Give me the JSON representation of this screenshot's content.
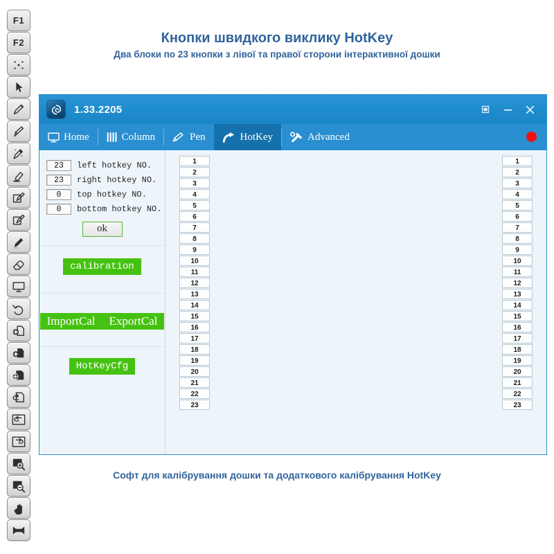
{
  "headings": {
    "title": "Кнопки швидкого виклику HotKey",
    "subtitle": "Два блоки по 23 кнопки з лівої та правої сторони інтерактивної дошки",
    "caption": "Софт для калібрування дошки та додаткового калібрування HotKey",
    "accent_color": "#31639c"
  },
  "toolbar": {
    "items": [
      {
        "name": "f1-key",
        "label": "F1",
        "icon": "text"
      },
      {
        "name": "f2-key",
        "label": "F2",
        "icon": "text"
      },
      {
        "name": "dots-grid",
        "label": "",
        "icon": "dots-icon"
      },
      {
        "name": "cursor-select",
        "label": "",
        "icon": "cursor-arrow-icon"
      },
      {
        "name": "pen-tool",
        "label": "",
        "icon": "pen-icon"
      },
      {
        "name": "pen-thin-tool",
        "label": "",
        "icon": "pen-thin-icon"
      },
      {
        "name": "magic-pen-tool",
        "label": "",
        "icon": "magic-pen-icon"
      },
      {
        "name": "highlighter-tool",
        "label": "",
        "icon": "highlighter-icon"
      },
      {
        "name": "edit-box-pen-1",
        "label": "",
        "icon": "edit-box-pen-icon"
      },
      {
        "name": "edit-box-pen-2",
        "label": "",
        "icon": "edit-box-pen-icon"
      },
      {
        "name": "marker-tool",
        "label": "",
        "icon": "marker-icon"
      },
      {
        "name": "eraser-tool",
        "label": "",
        "icon": "eraser-icon"
      },
      {
        "name": "whiteboard-tool",
        "label": "",
        "icon": "whiteboard-icon"
      },
      {
        "name": "undo-tool",
        "label": "",
        "icon": "undo-arrow-icon"
      },
      {
        "name": "page-add-outline",
        "label": "",
        "icon": "page-plus-outline-icon"
      },
      {
        "name": "page-add-half",
        "label": "",
        "icon": "page-plus-half-icon"
      },
      {
        "name": "page-add-solid",
        "label": "",
        "icon": "page-plus-solid-icon"
      },
      {
        "name": "page-back",
        "label": "",
        "icon": "page-back-icon"
      },
      {
        "name": "prev-page",
        "label": "",
        "icon": "arrow-left-icon"
      },
      {
        "name": "next-page",
        "label": "",
        "icon": "arrow-right-icon"
      },
      {
        "name": "zoom-in-tool",
        "label": "",
        "icon": "zoom-in-icon"
      },
      {
        "name": "zoom-out-tool",
        "label": "",
        "icon": "zoom-out-icon"
      },
      {
        "name": "pan-hand-tool",
        "label": "",
        "icon": "hand-icon"
      },
      {
        "name": "fullscreen-tool",
        "label": "",
        "icon": "fullscreen-icon"
      }
    ]
  },
  "window": {
    "title": "1.33.2205",
    "logo_icon": "spiral-logo-icon",
    "controls": [
      {
        "name": "restore-button",
        "icon": "restore-icon"
      },
      {
        "name": "minimize-button",
        "icon": "minimize-icon"
      },
      {
        "name": "close-button",
        "icon": "close-icon"
      }
    ],
    "titlebar_color": "#1f8ccd",
    "tabs": [
      {
        "label": "Home",
        "icon": "monitor-icon",
        "active": false
      },
      {
        "label": "Column",
        "icon": "columns-icon",
        "active": false
      },
      {
        "label": "Pen",
        "icon": "pencil-icon",
        "active": false
      },
      {
        "label": "HotKey",
        "icon": "curved-arrow-icon",
        "active": true
      },
      {
        "label": "Advanced",
        "icon": "hammer-wrench-icon",
        "active": false
      }
    ],
    "record_indicator": {
      "name": "record-dot",
      "color": "#ef1111"
    }
  },
  "settings": {
    "fields": [
      {
        "value": "23",
        "label": "left hotkey NO."
      },
      {
        "value": "23",
        "label": "right hotkey NO."
      },
      {
        "value": "0",
        "label": "top hotkey NO."
      },
      {
        "value": "0",
        "label": "bottom hotkey NO."
      }
    ],
    "ok_label": "ok",
    "buttons_group_1": [
      {
        "label": "calibration"
      }
    ],
    "buttons_group_2": [
      {
        "label": "ImportCal"
      },
      {
        "label": "ExportCal"
      }
    ],
    "buttons_group_3": [
      {
        "label": "HotKeyCfg"
      }
    ],
    "button_color": "#45c211"
  },
  "keys": {
    "left_column": [
      "1",
      "2",
      "3",
      "4",
      "5",
      "6",
      "7",
      "8",
      "9",
      "10",
      "11",
      "12",
      "13",
      "14",
      "15",
      "16",
      "17",
      "18",
      "19",
      "20",
      "21",
      "22",
      "23"
    ],
    "right_column": [
      "1",
      "2",
      "3",
      "4",
      "5",
      "6",
      "7",
      "8",
      "9",
      "10",
      "11",
      "12",
      "13",
      "14",
      "15",
      "16",
      "17",
      "18",
      "19",
      "20",
      "21",
      "22",
      "23"
    ]
  }
}
